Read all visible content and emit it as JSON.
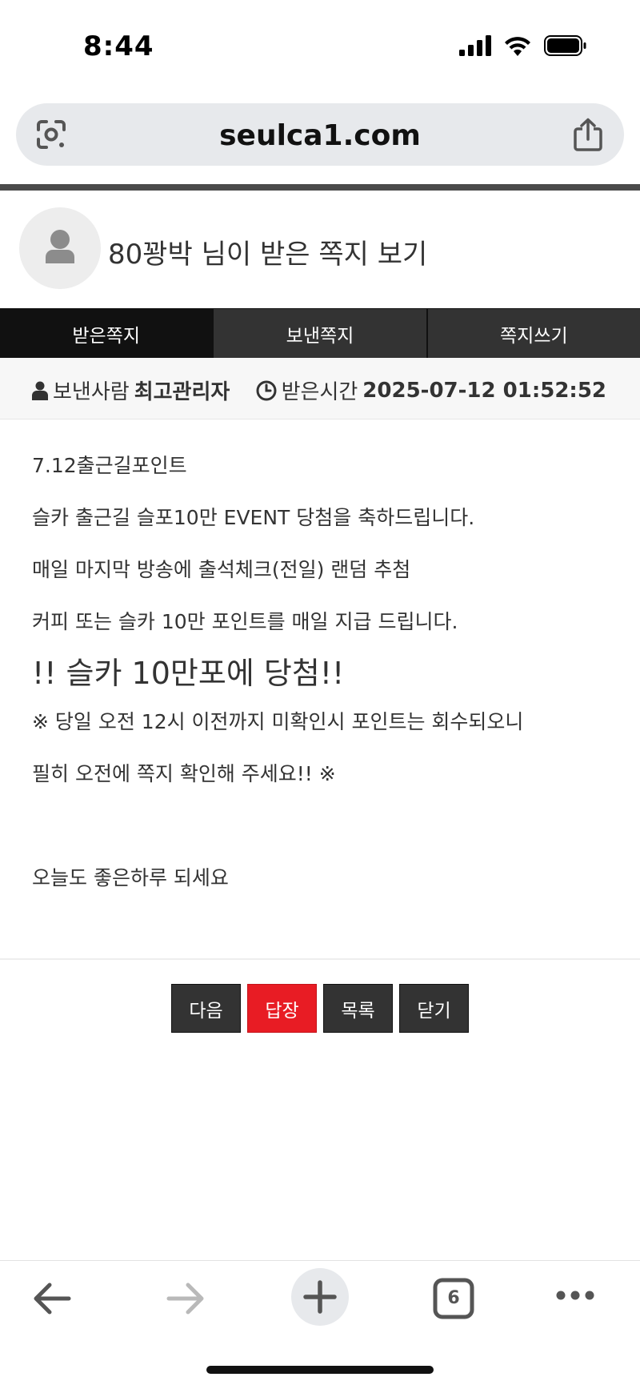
{
  "status_bar": {
    "time": "8:44",
    "icons": [
      "cellular-signal-icon",
      "wifi-icon",
      "battery-icon"
    ]
  },
  "browser": {
    "url": "seulca1.com",
    "icons": [
      "google-lens-icon",
      "share-icon"
    ]
  },
  "page": {
    "title": "80꽝박 님이 받은 쪽지 보기",
    "avatar_icon": "user-avatar-icon"
  },
  "tabs": [
    {
      "label": "받은쪽지",
      "active": true
    },
    {
      "label": "보낸쪽지",
      "active": false
    },
    {
      "label": "쪽지쓰기",
      "active": false
    }
  ],
  "info": {
    "sender_label": "보낸사람",
    "sender_name": "최고관리자",
    "received_label": "받은시간",
    "received_time": "2025-07-12 01:52:52",
    "sender_icon": "user-icon",
    "time_icon": "clock-icon"
  },
  "message": {
    "lines": [
      "7.12출근길포인트",
      "슬카 출근길 슬포10만 EVENT 당첨을 축하드립니다.",
      "매일 마지막 방송에 출석체크(전일) 랜덤 추첨",
      "커피 또는 슬카 10만 포인트를 매일 지급 드립니다.",
      "!! 슬카 10만포에 당첨!!",
      "※ 당일 오전 12시 이전까지 미확인시 포인트는 회수되오니",
      "필히 오전에 쪽지 확인해 주세요!! ※",
      "",
      "오늘도 좋은하루 되세요"
    ]
  },
  "buttons": {
    "next": "다음",
    "reply": "답장",
    "list": "목록",
    "close": "닫기"
  },
  "bottom_toolbar": {
    "tab_count": "6",
    "icons": [
      "back-arrow-icon",
      "forward-arrow-icon",
      "new-tab-plus-icon",
      "tab-switcher-icon",
      "more-options-icon"
    ]
  },
  "colors": {
    "tab_active": "#111111",
    "tab_inactive": "#333333",
    "reply_button": "#e81c24",
    "url_bar": "#e7e9ec"
  }
}
